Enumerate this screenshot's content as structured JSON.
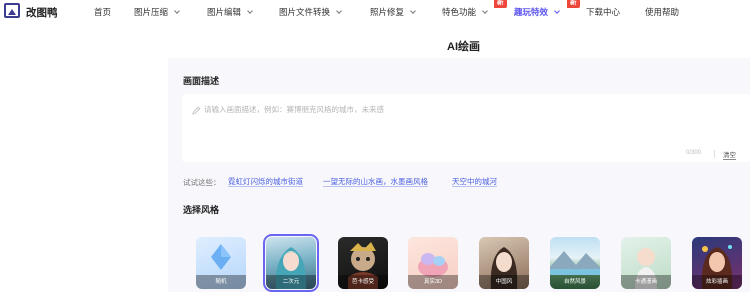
{
  "brand": {
    "name": "改图鸭"
  },
  "nav": {
    "items": [
      {
        "label": "首页",
        "has_menu": false
      },
      {
        "label": "图片压缩",
        "has_menu": true
      },
      {
        "label": "图片编辑",
        "has_menu": true
      },
      {
        "label": "图片文件转换",
        "has_menu": true
      },
      {
        "label": "照片修复",
        "has_menu": true
      },
      {
        "label": "特色功能",
        "has_menu": true,
        "badge": "新"
      },
      {
        "label": "趣玩特效",
        "has_menu": true,
        "badge": "新",
        "active": true
      },
      {
        "label": "下载中心",
        "has_menu": false
      },
      {
        "label": "使用帮助",
        "has_menu": false
      }
    ]
  },
  "page": {
    "title": "AI绘画"
  },
  "prompt": {
    "section_label": "画面描述",
    "placeholder": "请输入画面描述，例如：赛博朋克风格的城市，未来感",
    "counter": "0/300",
    "clear_label": "清空"
  },
  "suggestions": {
    "label": "试试这些：",
    "items": [
      "霓虹灯闪烁的城市街道",
      "一望无际的山水画，水墨画风格",
      "天空中的城河"
    ]
  },
  "styles": {
    "section_label": "选择风格",
    "items": [
      {
        "label": "随机"
      },
      {
        "label": "二次元",
        "selected": true
      },
      {
        "label": "芭卡感受"
      },
      {
        "label": "真实3D"
      },
      {
        "label": "中国风"
      },
      {
        "label": "自然风景"
      },
      {
        "label": "卡通漫画"
      },
      {
        "label": "炫彩插画"
      }
    ]
  },
  "colors": {
    "accent": "#5b55f0",
    "badge": "#f0473c",
    "link": "#4a5fe0"
  }
}
